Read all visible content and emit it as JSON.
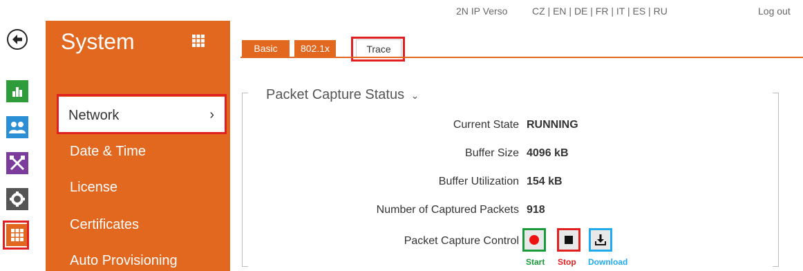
{
  "topbar": {
    "device": "2N IP Verso",
    "languages": "CZ | EN | DE | FR | IT | ES | RU",
    "logout": "Log out"
  },
  "rail": {
    "icons": [
      "back-icon",
      "stats-icon",
      "users-icon",
      "tools-icon",
      "gear-icon",
      "grid-icon"
    ]
  },
  "sidebar": {
    "title": "System",
    "items": [
      {
        "label": "Network",
        "active": true
      },
      {
        "label": "Date & Time"
      },
      {
        "label": "License"
      },
      {
        "label": "Certificates"
      },
      {
        "label": "Auto Provisioning"
      }
    ],
    "chevron": "›"
  },
  "tabs": [
    "Basic",
    "802.1x",
    "Trace"
  ],
  "panel": {
    "title": "Packet Capture Status",
    "title_caret": "⌄",
    "rows": [
      {
        "label": "Current State",
        "value": "RUNNING"
      },
      {
        "label": "Buffer Size",
        "value": "4096 kB"
      },
      {
        "label": "Buffer Utilization",
        "value": "154 kB"
      },
      {
        "label": "Number of Captured Packets",
        "value": "918"
      }
    ],
    "control_label": "Packet Capture Control",
    "controls": [
      {
        "label": "Start",
        "icon": "record-icon"
      },
      {
        "label": "Stop",
        "icon": "stop-icon"
      },
      {
        "label": "Download",
        "icon": "download-icon"
      }
    ]
  },
  "colors": {
    "brand_orange": "#e2671f",
    "highlight_red": "#e02020",
    "start_green": "#1a9a3a",
    "download_blue": "#22aaee"
  }
}
